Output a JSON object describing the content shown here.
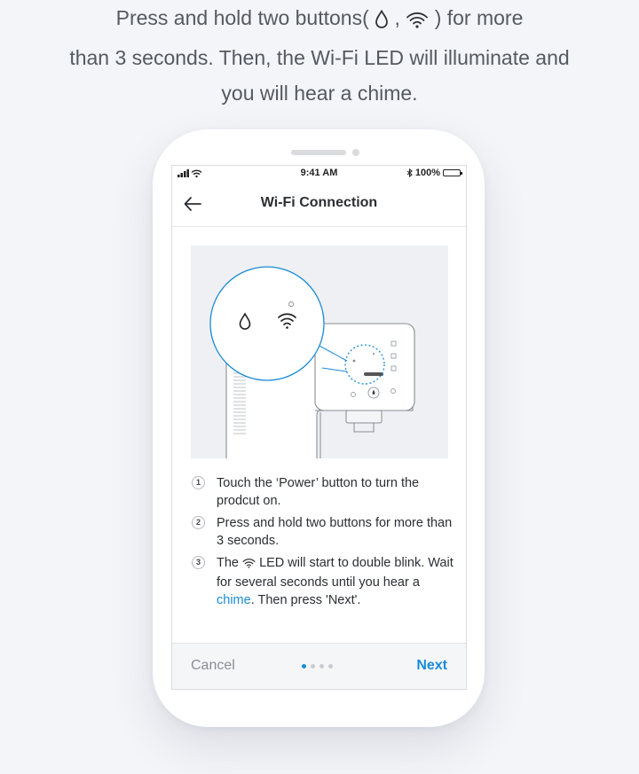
{
  "instruction": {
    "line1_before": "Press and hold two buttons(",
    "line1_sep": ",",
    "line1_after": ") for more",
    "line2": "than 3 seconds. Then, the Wi-Fi LED will illuminate and",
    "line3": "you will hear a chime.",
    "icons": [
      "water-drop-icon",
      "wifi-icon"
    ]
  },
  "status_bar": {
    "time": "9:41 AM",
    "battery": "100%",
    "battery_level": 1.0
  },
  "nav": {
    "title": "Wi-Fi Connection"
  },
  "steps": [
    {
      "number": "1",
      "text": "Touch the ‘Power’ button to turn the prodcut on."
    },
    {
      "number": "2",
      "text": "Press and hold two buttons for more than 3 seconds."
    },
    {
      "number": "3",
      "text_before": "The",
      "text_mid": "LED will start to double blink. Wait for several seconds until you hear a",
      "link": "chime",
      "text_after": ". Then press 'Next'."
    }
  ],
  "footer": {
    "cancel_label": "Cancel",
    "next_label": "Next",
    "page_count": 4,
    "current_page": 1
  },
  "colors": {
    "accent": "#1a8ad8",
    "background": "#f4f5f8",
    "text": "#2b2e33",
    "muted": "#8a8e95"
  }
}
